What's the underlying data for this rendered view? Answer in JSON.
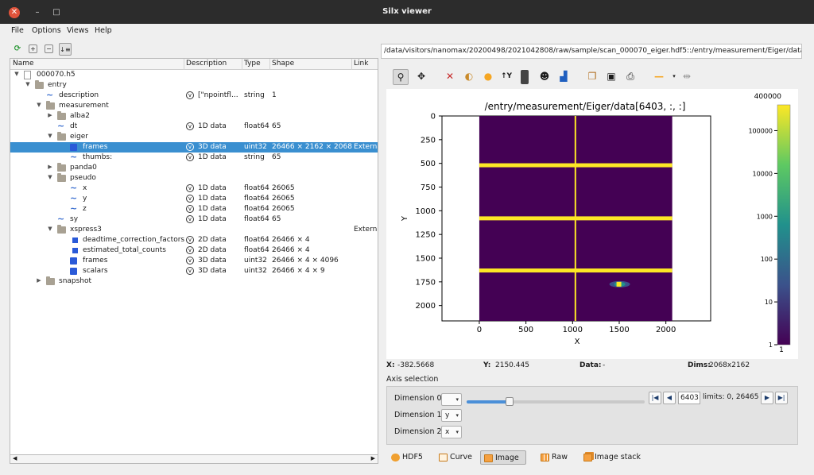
{
  "window": {
    "title": "Silx viewer",
    "close_glyph": "✕",
    "min_glyph": "–",
    "max_glyph": "□"
  },
  "menu": [
    "File",
    "Options",
    "Views",
    "Help"
  ],
  "tree": {
    "headers": [
      "Name",
      "Description",
      "Type",
      "Shape",
      "Link"
    ],
    "rows": [
      {
        "name": "000070.h5",
        "desc": "",
        "type": "",
        "shape": "",
        "link": ""
      },
      {
        "name": "entry",
        "desc": "",
        "type": "",
        "shape": "",
        "link": ""
      },
      {
        "name": "description",
        "desc": "[\"npointfl...",
        "type": "string",
        "shape": "1",
        "link": ""
      },
      {
        "name": "measurement",
        "desc": "",
        "type": "",
        "shape": "",
        "link": ""
      },
      {
        "name": "alba2",
        "desc": "",
        "type": "",
        "shape": "",
        "link": ""
      },
      {
        "name": "dt",
        "desc": "1D data",
        "type": "float64",
        "shape": "65",
        "link": ""
      },
      {
        "name": "eiger",
        "desc": "",
        "type": "",
        "shape": "",
        "link": ""
      },
      {
        "name": "frames",
        "desc": "3D data",
        "type": "uint32",
        "shape": "26466 × 2162 × 2068",
        "link": "Externa"
      },
      {
        "name": "thumbs:",
        "desc": "1D data",
        "type": "string",
        "shape": "65",
        "link": ""
      },
      {
        "name": "panda0",
        "desc": "",
        "type": "",
        "shape": "",
        "link": ""
      },
      {
        "name": "pseudo",
        "desc": "",
        "type": "",
        "shape": "",
        "link": ""
      },
      {
        "name": "x",
        "desc": "1D data",
        "type": "float64",
        "shape": "26065",
        "link": ""
      },
      {
        "name": "y",
        "desc": "1D data",
        "type": "float64",
        "shape": "26065",
        "link": ""
      },
      {
        "name": "z",
        "desc": "1D data",
        "type": "float64",
        "shape": "26065",
        "link": ""
      },
      {
        "name": "sy",
        "desc": "1D data",
        "type": "float64",
        "shape": "65",
        "link": ""
      },
      {
        "name": "xspress3",
        "desc": "",
        "type": "",
        "shape": "",
        "link": "Externa"
      },
      {
        "name": "deadtime_correction_factors",
        "desc": "2D data",
        "type": "float64",
        "shape": "26466 × 4",
        "link": ""
      },
      {
        "name": "estimated_total_counts",
        "desc": "2D data",
        "type": "float64",
        "shape": "26466 × 4",
        "link": ""
      },
      {
        "name": "frames",
        "desc": "3D data",
        "type": "uint32",
        "shape": "26466 × 4 × 4096",
        "link": ""
      },
      {
        "name": "scalars",
        "desc": "3D data",
        "type": "uint32",
        "shape": "26466 × 4 × 9",
        "link": ""
      },
      {
        "name": "snapshot",
        "desc": "",
        "type": "",
        "shape": "",
        "link": ""
      }
    ]
  },
  "path": "/data/visitors/nanomax/20200498/2021042808/raw/sample/scan_000070_eiger.hdf5::/entry/measurement/Eiger/data",
  "plot": {
    "title": "/entry/measurement/Eiger/data[6403, :, :]",
    "xlabel": "X",
    "ylabel": "Y",
    "xticks": [
      "0",
      "500",
      "1000",
      "1500",
      "2000"
    ],
    "yticks": [
      "0",
      "250",
      "500",
      "750",
      "1000",
      "1250",
      "1500",
      "1750",
      "2000"
    ],
    "colorbar_max": "400000",
    "colorbar_ticks": [
      "100000",
      "10000",
      "1000",
      "100",
      "10",
      "1"
    ],
    "colorbar_min": "1"
  },
  "chart_data": {
    "type": "heatmap",
    "title": "/entry/measurement/Eiger/data[6403, :, :]",
    "xlabel": "X",
    "ylabel": "Y",
    "xlim": [
      -400,
      2480
    ],
    "ylim": [
      2162,
      0
    ],
    "image_extent": {
      "x": [
        0,
        2068
      ],
      "y": [
        0,
        2162
      ]
    },
    "colormap": "viridis",
    "color_scale": "log",
    "color_range": [
      1,
      400000
    ],
    "horizontal_bright_lines_y": [
      520,
      1080,
      1630
    ],
    "vertical_bright_line_x": 1030,
    "hotspot": {
      "x": 1505,
      "y": 1775
    }
  },
  "status": {
    "x_label": "X:",
    "x_value": "-382.5668",
    "y_label": "Y:",
    "y_value": "2150.445",
    "data_label": "Data:",
    "data_value": "-",
    "dims_label": "Dims:",
    "dims_value": "2068x2162"
  },
  "axis_selection": {
    "title": "Axis selection",
    "dim0_label": "Dimension 0",
    "dim1_label": "Dimension 1",
    "dim2_label": "Dimension 2",
    "dim0_value": "",
    "dim1_value": "y",
    "dim2_value": "x",
    "frame": "6403",
    "limits": "limits: 0, 26465",
    "slider_fraction": 0.242
  },
  "tabs": [
    "HDF5",
    "Curve",
    "Image",
    "Raw",
    "Image stack"
  ],
  "colors": {
    "selection": "#3a8fd0",
    "bright_line": "#fde725",
    "image_bg": "#440154"
  }
}
